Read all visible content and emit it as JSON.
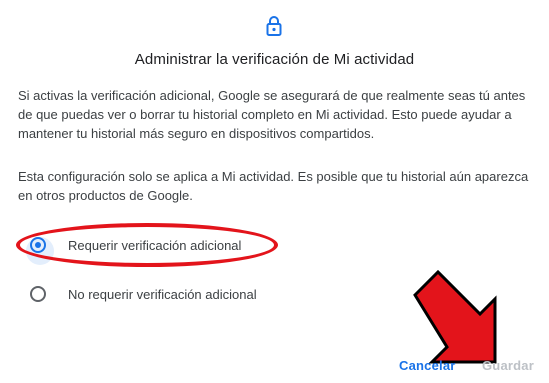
{
  "dialog": {
    "title": "Administrar la verificación de Mi actividad",
    "paragraph1": "Si activas la verificación adicional, Google se asegurará de que realmente seas tú antes de que puedas ver o borrar tu historial completo en Mi actividad. Esto puede ayudar a mantener tu historial más seguro en dispositivos compartidos.",
    "paragraph2": "Esta configuración solo se aplica a Mi actividad. Es posible que tu historial aún aparezca en otros productos de Google.",
    "options": [
      {
        "label": "Requerir verificación adicional",
        "selected": true
      },
      {
        "label": "No requerir verificación adicional",
        "selected": false
      }
    ],
    "buttons": {
      "cancel": "Cancelar",
      "save": "Guardar"
    }
  },
  "icons": {
    "header": "lock-icon"
  },
  "colors": {
    "accent": "#1a73e8",
    "annotation": "#e3141b",
    "disabled": "#bdc1c6",
    "text": "#3c4043"
  }
}
